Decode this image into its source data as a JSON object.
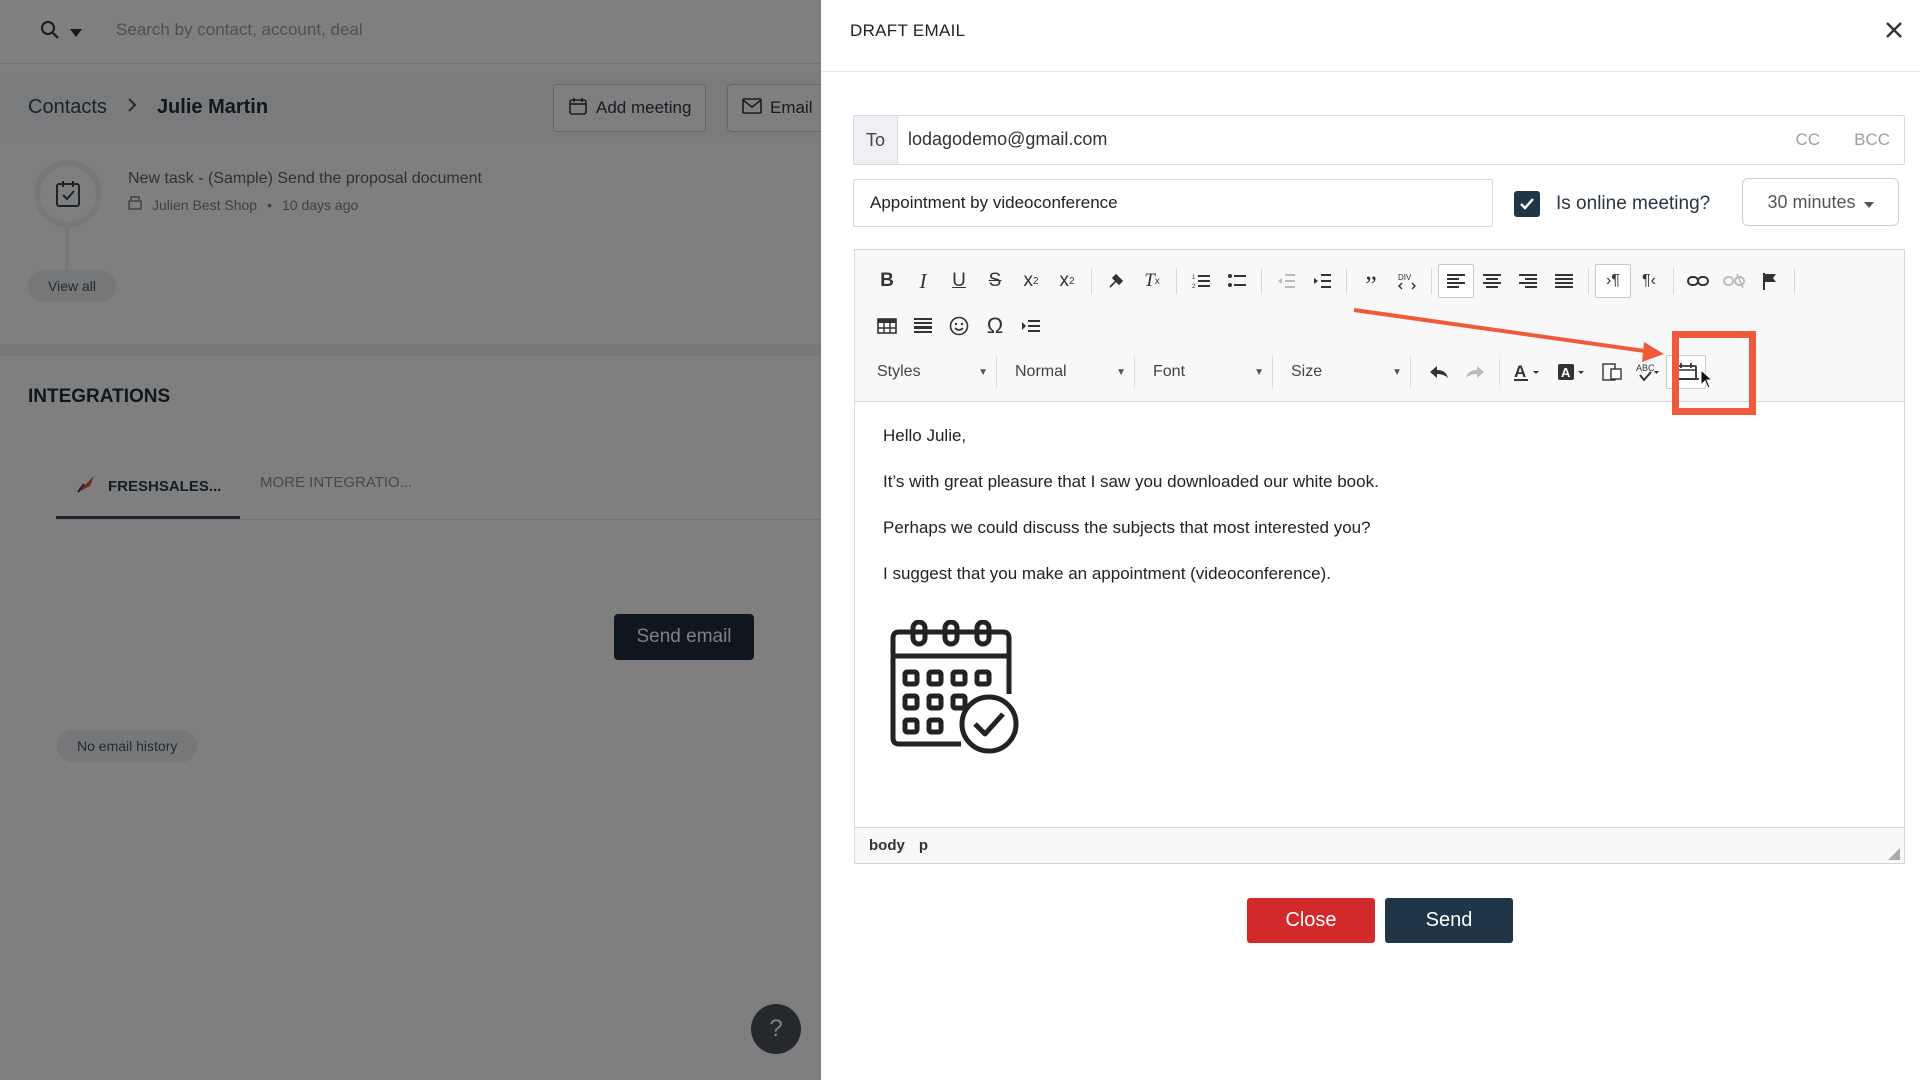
{
  "background": {
    "search_placeholder": "Search by contact, account, deal",
    "breadcrumb": {
      "root": "Contacts",
      "current": "Julie Martin"
    },
    "header_buttons": {
      "add_meeting": "Add meeting",
      "email": "Email"
    },
    "task": {
      "title": "New task - (Sample) Send the proposal document",
      "account": "Julien Best Shop",
      "age": "10 days ago"
    },
    "view_all": "View all",
    "integrations_title": "INTEGRATIONS",
    "tabs": [
      {
        "label": "FRESHSALES..."
      },
      {
        "label": "MORE INTEGRATIO..."
      }
    ],
    "send_email_button": "Send email",
    "no_history": "No email history",
    "help": "?"
  },
  "draft": {
    "title": "DRAFT EMAIL",
    "to_label": "To",
    "to_value": "lodagodemo@gmail.com",
    "cc": "CC",
    "bcc": "BCC",
    "subject": "Appointment by videoconference",
    "online_meeting_label": "Is online meeting?",
    "online_meeting_checked": true,
    "duration": "30 minutes",
    "toolbar": {
      "styles": "Styles",
      "format": "Normal",
      "font": "Font",
      "size": "Size"
    },
    "body": {
      "lines": [
        "Hello Julie,",
        "It’s with great pleasure that I saw you downloaded our white book.",
        "Perhaps we could discuss the subjects that most interested you?",
        "I suggest that you make an appointment (videoconference)."
      ]
    },
    "status_path": {
      "p1": "body",
      "p2": "p"
    },
    "buttons": {
      "close": "Close",
      "send": "Send"
    }
  },
  "colors": {
    "primary_dark": "#1f3548",
    "danger": "#d22a2a",
    "annotation": "#f05a3c"
  }
}
